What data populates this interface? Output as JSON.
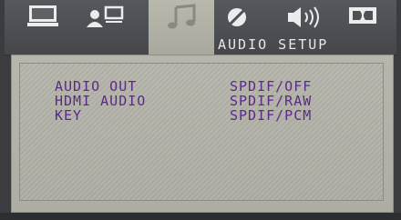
{
  "menu": {
    "tabs": [
      {
        "icon": "monitor-icon",
        "active": false
      },
      {
        "icon": "user-network-icon",
        "active": false
      },
      {
        "icon": "music-note-icon",
        "active": true
      },
      {
        "icon": "circle-slash-icon",
        "active": false
      },
      {
        "icon": "speaker-icon",
        "active": false
      },
      {
        "icon": "dolby-icon",
        "active": false
      }
    ],
    "section_title": "AUDIO SETUP"
  },
  "settings": {
    "labels": [
      "AUDIO OUT",
      "HDMI AUDIO",
      "KEY"
    ],
    "options": [
      "SPDIF/OFF",
      "SPDIF/RAW",
      "SPDIF/PCM"
    ]
  },
  "colors": {
    "text": "#5a2a8a",
    "panel": "#b7b6ad",
    "bar": "#4d5055"
  }
}
